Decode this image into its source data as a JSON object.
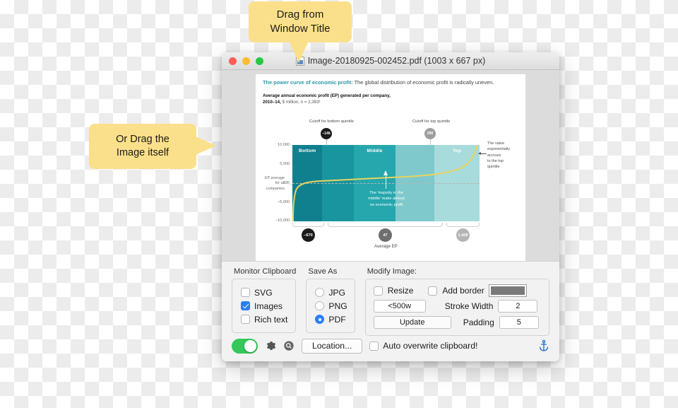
{
  "callouts": {
    "title_drag": "Drag from\nWindow Title",
    "title_drag_line1": "Drag from",
    "title_drag_line2": "Window Title",
    "image_drag_line1": "Or Drag the",
    "image_drag_line2": "Image itself"
  },
  "window": {
    "title": "Image-20180925-002452.pdf (1003 x 667 px)",
    "doc_icon": "pdf-document-icon",
    "traffic_lights": [
      "close",
      "minimize",
      "maximize"
    ]
  },
  "document": {
    "headline_highlight": "The power curve of economic profit:",
    "headline_rest": " The global distribution of economic profit is radically uneven.",
    "subtitle_bold": "Average annual economic profit (EP) generated per company,",
    "subtitle_bold2": "2010–14,",
    "subtitle_rest": " $ million, n = 2,393¹"
  },
  "chart_data": {
    "type": "line",
    "title": "The power curve of economic profit",
    "subtitle": "Average annual economic profit (EP) generated per company, 2010–14, $ million, n = 2,393",
    "xlabel": "Average EP",
    "ylabel": "",
    "ylim": [
      -10000,
      10000
    ],
    "yticks": [
      10000,
      5000,
      180,
      -5000,
      -10000
    ],
    "ytick_labels": [
      "10,000",
      "5,000",
      "180",
      "–5,000",
      "–10,000"
    ],
    "zero_reference_label": "EP average for all companies",
    "zero_reference_value": 180,
    "grid": false,
    "legend": "none",
    "bands": [
      {
        "label": "Bottom",
        "color": "#10808f",
        "width_pct": 16
      },
      {
        "label": "",
        "color": "#19959f",
        "width_pct": 17
      },
      {
        "label": "Middle",
        "color": "#25a7ad",
        "width_pct": 22
      },
      {
        "label": "",
        "color": "#7fc9cc",
        "width_pct": 21
      },
      {
        "label": "Top",
        "color": "#a8dbdb",
        "width_pct": 24
      }
    ],
    "curve_color": "#e8d45e",
    "annotations": [
      {
        "name": "cutoff-bottom-quintile",
        "label": "Cutoff for bottom quintile",
        "value": "–146",
        "marker_color": "#1b1b1b"
      },
      {
        "name": "cutoff-top-quintile",
        "label": "Cutoff for top quintile",
        "value": "296",
        "marker_color": "#9d9d9d"
      },
      {
        "name": "middle-note",
        "text": "The 'majority in the middle' make almost no economic profit"
      },
      {
        "name": "right-note",
        "text": "The value exponentially accrues to the top quintile"
      }
    ],
    "quintile_averages": [
      {
        "label": "Bottom",
        "value": "–670",
        "marker_color": "#1b1b1b"
      },
      {
        "label": "Middle",
        "value": "47",
        "marker_color": "#6e6e6e"
      },
      {
        "label": "Top",
        "value": "1,428",
        "marker_color": "#b5b5b5"
      }
    ],
    "x": [
      0,
      2,
      5,
      10,
      20,
      35,
      50,
      65,
      78,
      86,
      92,
      96,
      98,
      100
    ],
    "y": [
      -10000,
      -3200,
      -1200,
      -400,
      60,
      150,
      200,
      340,
      700,
      1400,
      2600,
      5200,
      7600,
      10000
    ]
  },
  "panel": {
    "monitor_clipboard": {
      "title": "Monitor Clipboard",
      "options": [
        {
          "label": "SVG",
          "checked": false
        },
        {
          "label": "Images",
          "checked": true
        },
        {
          "label": "Rich text",
          "checked": false
        }
      ]
    },
    "save_as": {
      "title": "Save As",
      "options": [
        {
          "label": "JPG",
          "selected": false
        },
        {
          "label": "PNG",
          "selected": false
        },
        {
          "label": "PDF",
          "selected": true
        }
      ]
    },
    "modify_image": {
      "title": "Modify Image:",
      "resize_label": "Resize",
      "resize_checked": false,
      "add_border_label": "Add border",
      "add_border_checked": false,
      "border_color": "#7a7a7a",
      "resize_value": "<500w",
      "update_label": "Update",
      "stroke_width_label": "Stroke Width",
      "stroke_width_value": "2",
      "padding_label": "Padding",
      "padding_value": "5"
    }
  },
  "bottom_bar": {
    "power_toggle_on": true,
    "power_toggle_color": "#34c759",
    "gear_icon": "gear-icon",
    "search_icon": "magnifier-icon",
    "location_label": "Location...",
    "auto_overwrite_label": "Auto overwrite clipboard!",
    "auto_overwrite_checked": false,
    "anchor_icon": "anchor-icon",
    "anchor_color": "#1a6fd4"
  }
}
